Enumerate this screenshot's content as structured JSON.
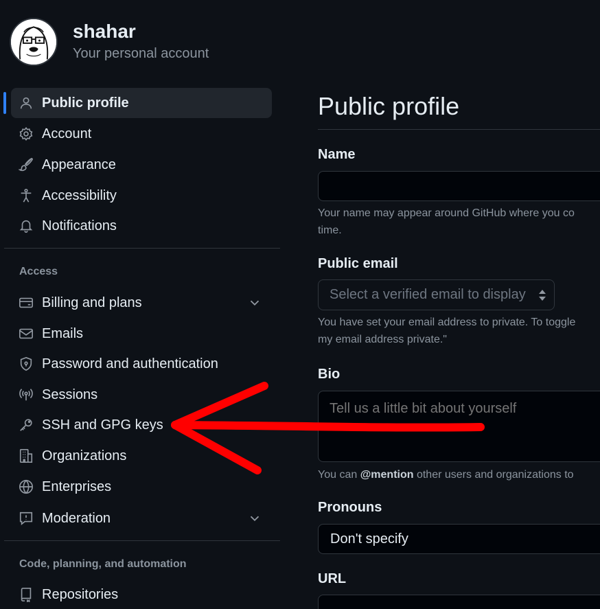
{
  "header": {
    "username": "shahar",
    "account_subtitle": "Your personal account"
  },
  "sidebar": {
    "top_items": [
      {
        "label": "Public profile",
        "icon": "person-icon",
        "active": true
      },
      {
        "label": "Account",
        "icon": "gear-icon"
      },
      {
        "label": "Appearance",
        "icon": "paintbrush-icon"
      },
      {
        "label": "Accessibility",
        "icon": "accessibility-icon"
      },
      {
        "label": "Notifications",
        "icon": "bell-icon"
      }
    ],
    "access_section_label": "Access",
    "access_items": [
      {
        "label": "Billing and plans",
        "icon": "credit-card-icon",
        "expandable": true
      },
      {
        "label": "Emails",
        "icon": "mail-icon"
      },
      {
        "label": "Password and authentication",
        "icon": "shield-lock-icon"
      },
      {
        "label": "Sessions",
        "icon": "broadcast-icon"
      },
      {
        "label": "SSH and GPG keys",
        "icon": "key-icon"
      },
      {
        "label": "Organizations",
        "icon": "organization-icon"
      },
      {
        "label": "Enterprises",
        "icon": "globe-icon"
      },
      {
        "label": "Moderation",
        "icon": "report-icon",
        "expandable": true
      }
    ],
    "code_section_label": "Code, planning, and automation",
    "code_items": [
      {
        "label": "Repositories",
        "icon": "repo-icon"
      }
    ]
  },
  "main": {
    "title": "Public profile",
    "name_label": "Name",
    "name_value": "",
    "name_hint_line1": "Your name may appear around GitHub where you co",
    "name_hint_line2": "time.",
    "email_label": "Public email",
    "email_placeholder": "Select a verified email to display",
    "email_hint_line1": "You have set your email address to private. To toggle",
    "email_hint_line2": "my email address private.\"",
    "bio_label": "Bio",
    "bio_placeholder": "Tell us a little bit about yourself",
    "bio_hint_prefix": "You can ",
    "bio_hint_mention": "@mention",
    "bio_hint_suffix": " other users and organizations to",
    "pronouns_label": "Pronouns",
    "pronouns_value": "Don't specify",
    "url_label": "URL"
  },
  "colors": {
    "background": "#0d1117",
    "active_indicator": "#2f81f7",
    "annotation_arrow": "#ff0000"
  }
}
